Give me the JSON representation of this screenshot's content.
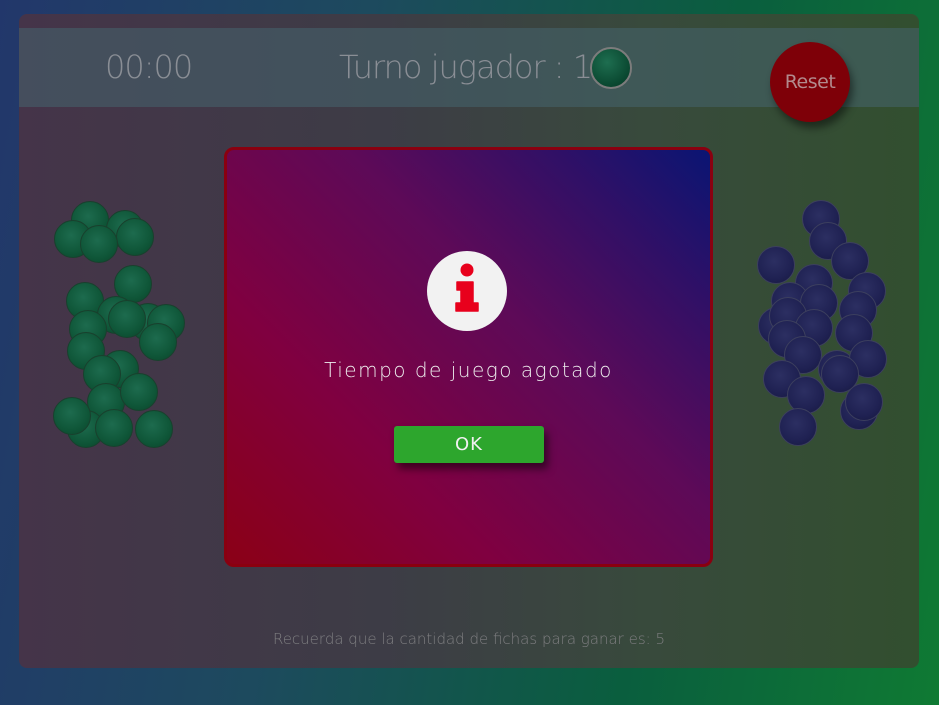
{
  "header": {
    "timer": "00:00",
    "turn_label": "Turno jugador : 1",
    "reset_label": "Reset"
  },
  "footer": {
    "hint": "Recuerda que la cantidad de fichas para ganar es: 5"
  },
  "modal": {
    "icon": "info-icon",
    "message": "Tiempo de juego agotado",
    "ok_label": "OK"
  },
  "colors": {
    "player1_chip": "#0f5638",
    "player2_chip": "#1f2152",
    "reset_button": "#7e0008",
    "ok_button": "#2da62d",
    "info_icon": "#e8001c"
  }
}
